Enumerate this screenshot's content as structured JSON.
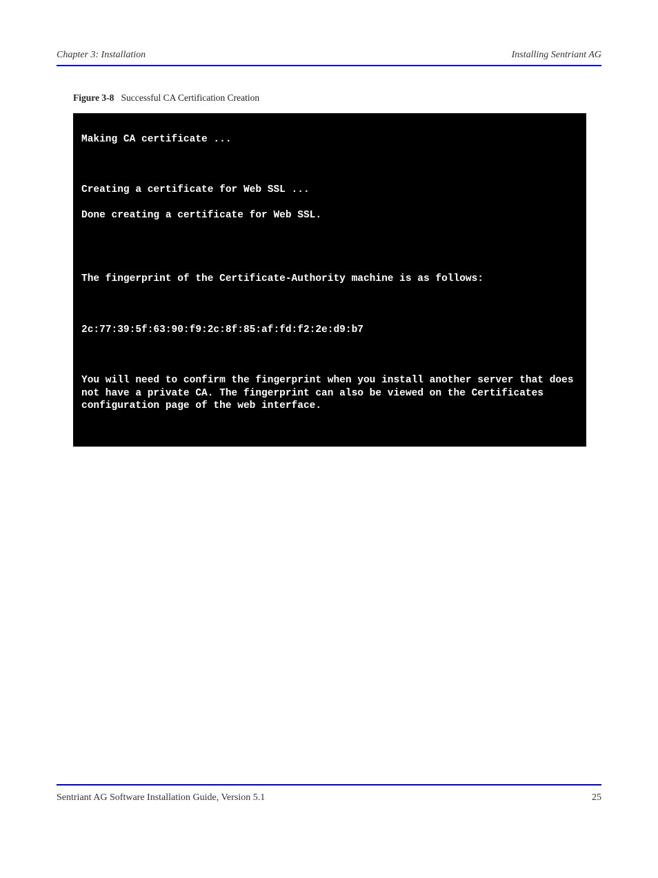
{
  "header": {
    "left": "Chapter 3: Installation",
    "right": "Installing Sentriant AG"
  },
  "figure": {
    "label": "Figure 3-8",
    "title": "Successful CA Certification Creation"
  },
  "terminal": {
    "line1": "Making CA certificate ...",
    "line2": "Creating a certificate for Web SSL ...",
    "line3": "Done creating a certificate for Web SSL.",
    "line4": "The fingerprint of the Certificate-Authority machine is as follows:",
    "line5": "2c:77:39:5f:63:90:f9:2c:8f:85:af:fd:f2:2e:d9:b7",
    "line6": "You will need to confirm the fingerprint when you install another server that does not have a private CA. The fingerprint can also be viewed on the Certificates configuration page of the web interface."
  },
  "footer": {
    "left": "Sentriant AG Software Installation Guide, Version 5.1",
    "right": "25"
  }
}
